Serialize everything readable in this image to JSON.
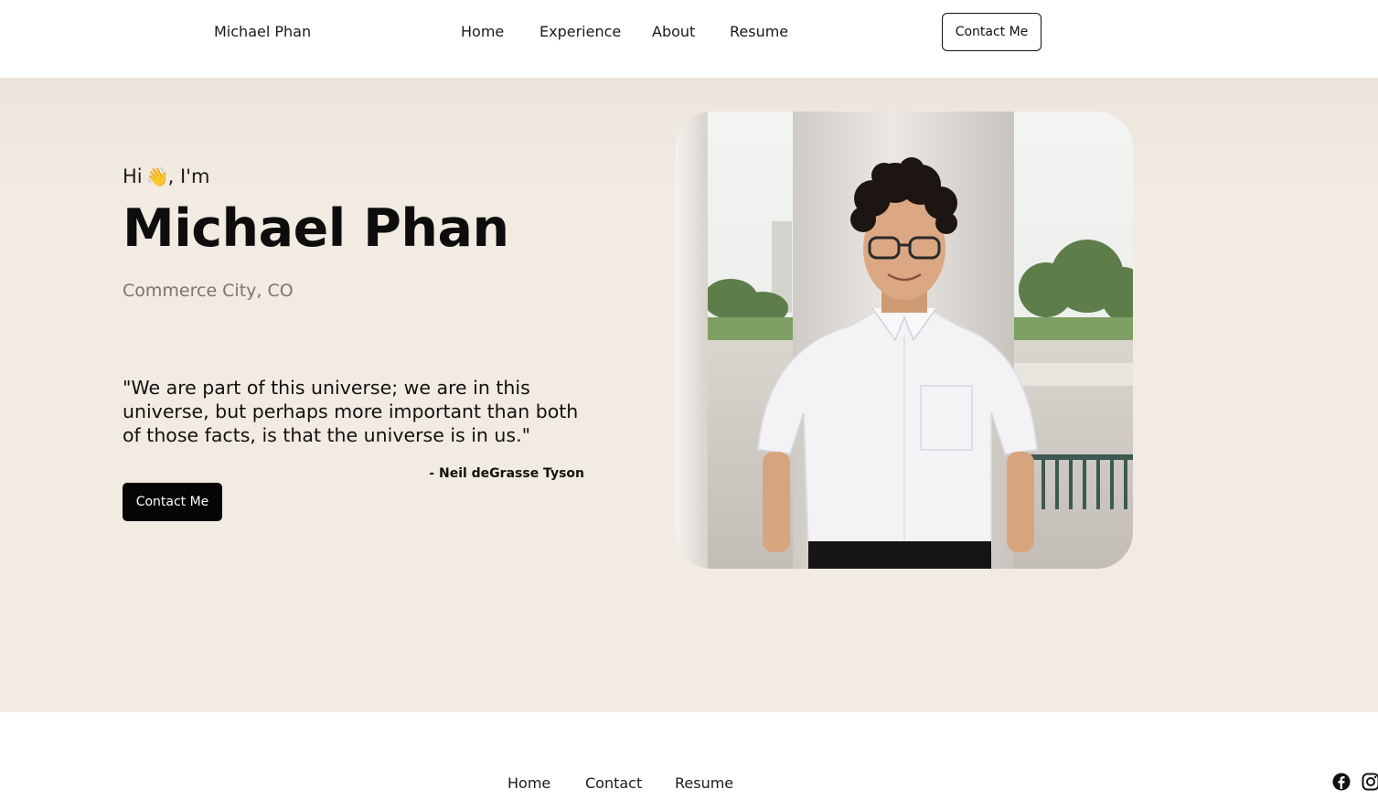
{
  "nav": {
    "brand": "Michael Phan",
    "links": [
      {
        "label": "Home"
      },
      {
        "label": "Experience"
      },
      {
        "label": "About"
      },
      {
        "label": "Resume"
      }
    ],
    "contact_label": "Contact Me"
  },
  "hero": {
    "greeting_prefix": "Hi",
    "wave_emoji": "👋",
    "greeting_suffix": ", I'm",
    "name": "Michael Phan",
    "location": "Commerce City, CO",
    "quote": "\"We are part of this universe; we are in this universe, but perhaps more important than both of those facts, is that the universe is in us.\"",
    "quote_author": "- Neil deGrasse Tyson",
    "contact_label": "Contact Me"
  },
  "footer": {
    "links": [
      {
        "label": "Home"
      },
      {
        "label": "Contact"
      },
      {
        "label": "Resume"
      }
    ],
    "social_icons": [
      "facebook-icon",
      "instagram-icon"
    ]
  },
  "colors": {
    "hero_bg": "#f2ebe1",
    "primary_button": "#050505",
    "location_text": "#7a7570"
  }
}
